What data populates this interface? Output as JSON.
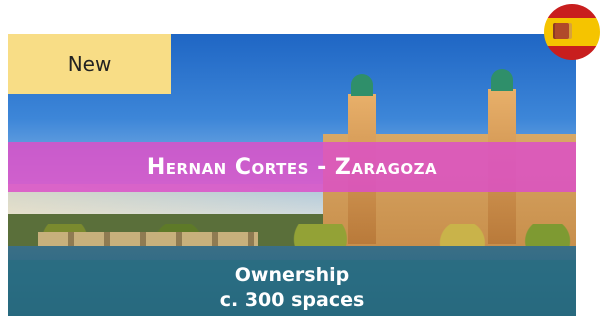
{
  "badge": {
    "label": "New"
  },
  "banner": {
    "title": "Hernan Cortes - Zaragoza"
  },
  "details": {
    "line1": "Ownership",
    "line2": "c. 300 spaces"
  },
  "icons": {
    "flag": "spain-flag-icon"
  },
  "colors": {
    "badge_bg": "#f8dd86",
    "banner_bg": "#dc50c8",
    "bottom_band_bg": "#286e82"
  }
}
